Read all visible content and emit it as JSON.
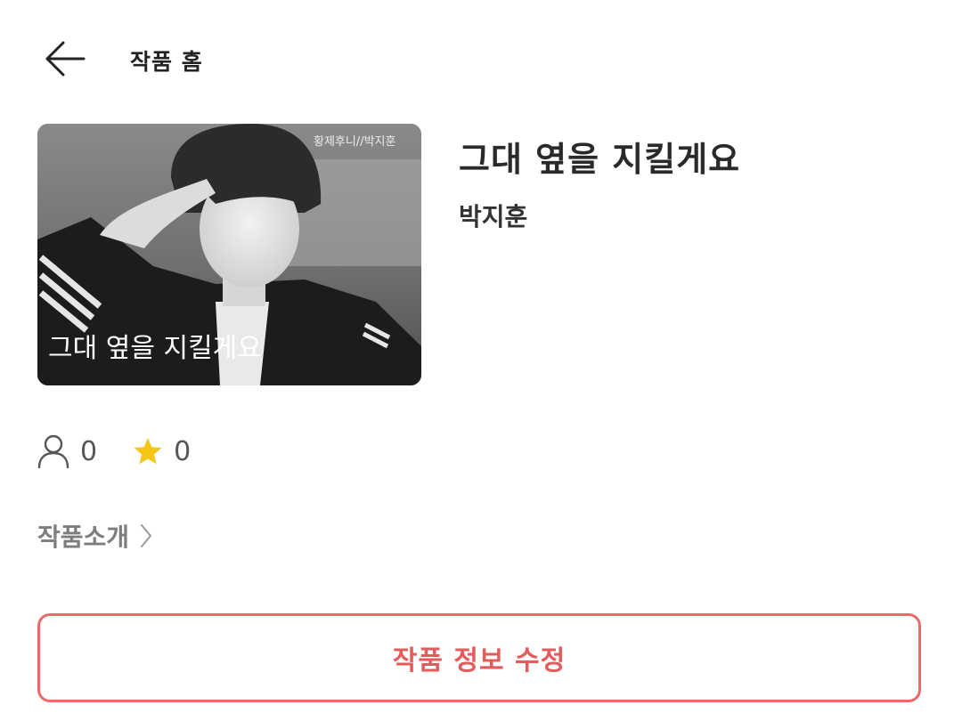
{
  "header": {
    "back_icon": "arrow-left-icon",
    "title": "작품 홈"
  },
  "work": {
    "cover": {
      "overlay_title": "그대 옆을 지킬게요",
      "watermark": "황제후니//박지훈"
    },
    "title": "그대 옆을 지킬게요",
    "author": "박지훈"
  },
  "stats": {
    "readers_icon": "person-icon",
    "readers": "0",
    "stars_icon": "star-icon",
    "stars": "0",
    "star_color": "#f5c518"
  },
  "intro": {
    "label": "작품소개",
    "icon": "chevron-right-icon"
  },
  "actions": {
    "edit_label": "작품 정보 수정",
    "accent_color": "#e35b5b"
  }
}
